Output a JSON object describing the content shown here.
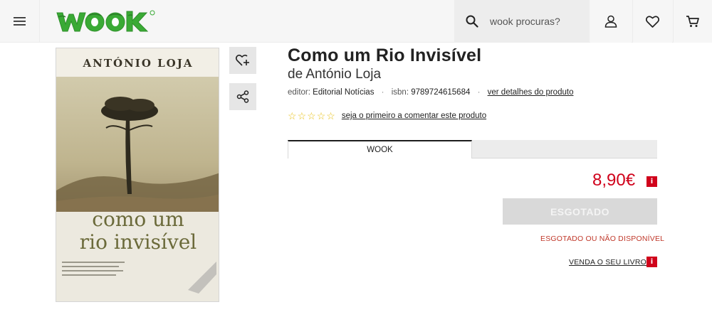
{
  "header": {
    "search_placeholder": "wook procuras?",
    "logo_text": "WOOK"
  },
  "cover": {
    "author_text": "ANTÓNIO LOJA",
    "title_text_line1": "como um",
    "title_text_line2": "rio invisível"
  },
  "product": {
    "title": "Como um Rio Invisível",
    "author_prefix": "de",
    "author": "António Loja",
    "publisher_label": "editor:",
    "publisher": "Editorial Notícias",
    "isbn_label": "isbn:",
    "isbn": "9789724615684",
    "details_link": "ver detalhes do produto",
    "rating_link": "seja o primeiro a comentar este produto",
    "rating_stars": 0,
    "rating_max": 5
  },
  "tabs": [
    {
      "label": "WOOK",
      "active": true
    },
    {
      "label": "",
      "active": false
    }
  ],
  "purchase": {
    "price": "8,90€",
    "info_badge": "i",
    "sold_out_label": "ESGOTADO",
    "unavailable_text": "ESGOTADO OU NÃO DISPONÍVEL",
    "sell_link": "VENDA O SEU LIVRO"
  },
  "colors": {
    "brand_green": "#3aaa35",
    "price_red": "#d0021b",
    "star_yellow": "#e8c21c"
  },
  "icons": [
    "menu-icon",
    "search-icon",
    "user-icon",
    "heart-icon",
    "cart-icon",
    "wishlist-add-icon",
    "share-icon",
    "info-icon"
  ]
}
